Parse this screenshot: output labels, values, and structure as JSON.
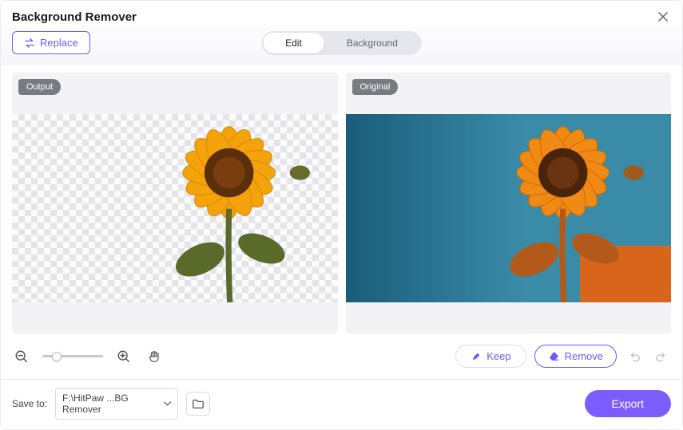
{
  "header": {
    "title": "Background Remover"
  },
  "toolbar": {
    "replace_label": "Replace",
    "seg": {
      "edit": "Edit",
      "background": "Background",
      "active": "edit"
    }
  },
  "panels": {
    "output_badge": "Output",
    "original_badge": "Original"
  },
  "lower": {
    "keep_label": "Keep",
    "remove_label": "Remove"
  },
  "footer": {
    "saveto_label": "Save to:",
    "path_display": "F:\\HitPaw ...BG Remover",
    "export_label": "Export"
  },
  "colors": {
    "accent": "#7b5cff"
  }
}
